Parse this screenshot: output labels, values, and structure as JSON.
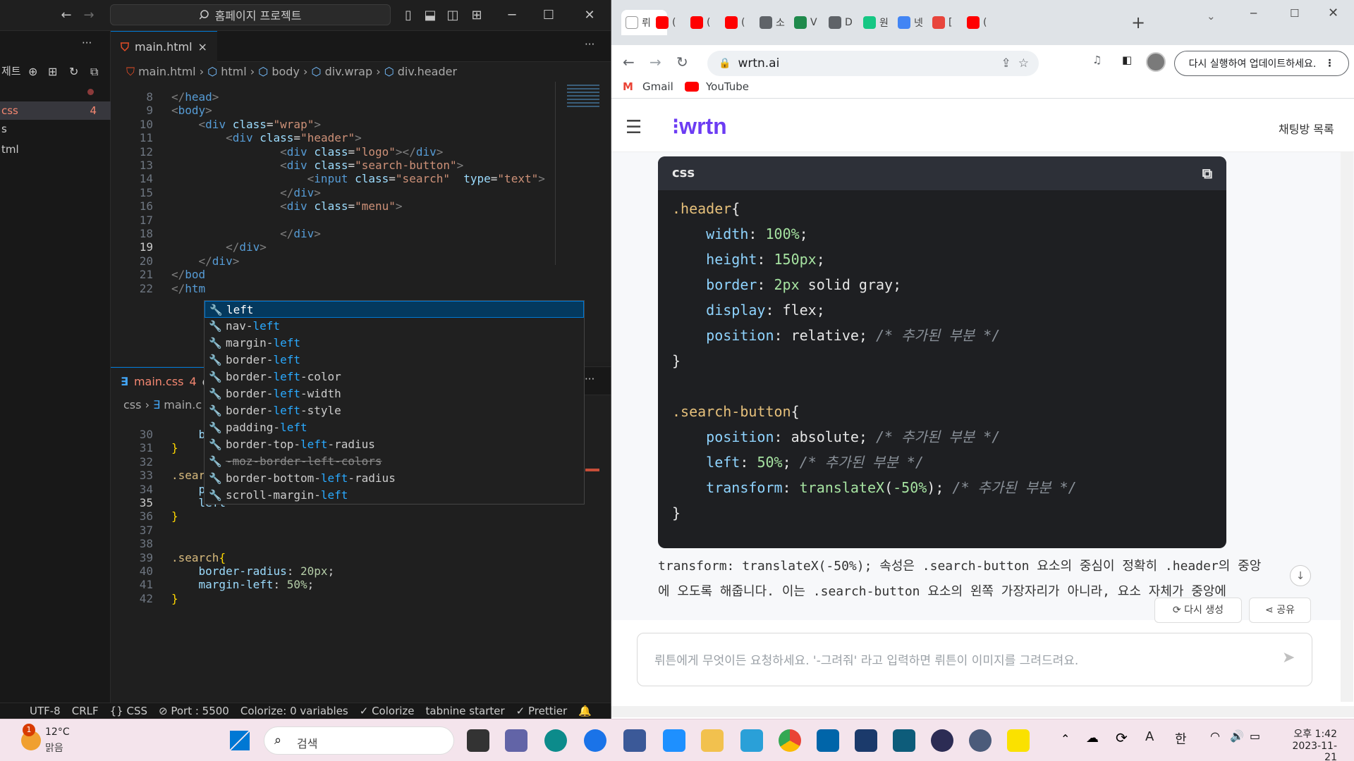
{
  "vscode": {
    "command_center": "홈페이지 프로젝트",
    "sidebar": {
      "item0": "제트",
      "item1": "css",
      "item1_badge": "4",
      "item2": "s",
      "item3": "tml"
    },
    "top_tab": {
      "label": "main.html",
      "close": "×"
    },
    "top_breadcrumb": [
      "main.html",
      "html",
      "body",
      "div.wrap",
      "div.header"
    ],
    "top_lines": [
      {
        "n": "8",
        "html": "<span class='t-punc'>&lt;/</span><span class='t-tag'>head</span><span class='t-punc'>&gt;</span>"
      },
      {
        "n": "9",
        "html": "<span class='t-punc'>&lt;</span><span class='t-tag'>body</span><span class='t-punc'>&gt;</span>"
      },
      {
        "n": "10",
        "html": "    <span class='t-punc'>&lt;</span><span class='t-tag'>div</span> <span class='t-attr'>class</span>=<span class='t-str'>\"wrap\"</span><span class='t-punc'>&gt;</span>"
      },
      {
        "n": "11",
        "html": "        <span class='t-punc'>&lt;</span><span class='t-tag'>div</span> <span class='t-attr'>class</span>=<span class='t-str'>\"header\"</span><span class='t-punc'>&gt;</span>"
      },
      {
        "n": "12",
        "html": "                <span class='t-punc'>&lt;</span><span class='t-tag'>div</span> <span class='t-attr'>class</span>=<span class='t-str'>\"logo\"</span><span class='t-punc'>&gt;&lt;/</span><span class='t-tag'>div</span><span class='t-punc'>&gt;</span>"
      },
      {
        "n": "13",
        "html": "                <span class='t-punc'>&lt;</span><span class='t-tag'>div</span> <span class='t-attr'>class</span>=<span class='t-str'>\"search-button\"</span><span class='t-punc'>&gt;</span>"
      },
      {
        "n": "14",
        "html": "                    <span class='t-punc'>&lt;</span><span class='t-tag'>input</span> <span class='t-attr'>class</span>=<span class='t-str'>\"search\"</span>  <span class='t-attr'>type</span>=<span class='t-str'>\"text\"</span><span class='t-punc'>&gt;</span>"
      },
      {
        "n": "15",
        "html": "                <span class='t-punc'>&lt;/</span><span class='t-tag'>div</span><span class='t-punc'>&gt;</span>"
      },
      {
        "n": "16",
        "html": "                <span class='t-punc'>&lt;</span><span class='t-tag'>div</span> <span class='t-attr'>class</span>=<span class='t-str'>\"menu\"</span><span class='t-punc'>&gt;</span>"
      },
      {
        "n": "17",
        "html": ""
      },
      {
        "n": "18",
        "html": "                <span class='t-punc'>&lt;/</span><span class='t-tag'>div</span><span class='t-punc'>&gt;</span>"
      },
      {
        "n": "19",
        "html": "        <span class='t-punc'>&lt;/</span><span class='t-tag'>div</span><span class='t-punc'>&gt;</span>"
      },
      {
        "n": "20",
        "html": "    <span class='t-punc'>&lt;/</span><span class='t-tag'>div</span><span class='t-punc'>&gt;</span>"
      },
      {
        "n": "21",
        "html": "<span class='t-punc'>&lt;/</span><span class='t-tag'>bod</span>"
      },
      {
        "n": "22",
        "html": "<span class='t-punc'>&lt;/</span><span class='t-tag'>htm</span>"
      }
    ],
    "bottom_tab": {
      "label": "main.css",
      "badge": "4"
    },
    "bottom_breadcrumb": [
      "css",
      "main.c"
    ],
    "bottom_lines": [
      {
        "n": "30",
        "html": "    <span class='t-prop'>b</span>"
      },
      {
        "n": "31",
        "html": "<span class='t-brace'>}</span>"
      },
      {
        "n": "32",
        "html": ""
      },
      {
        "n": "33",
        "html": "<span class='t-sel'>.sear</span>"
      },
      {
        "n": "34",
        "html": "    <span class='t-prop'>p</span>"
      },
      {
        "n": "35",
        "html": "    <span class='t-prop'>left</span>"
      },
      {
        "n": "36",
        "html": "<span class='t-brace'>}</span>"
      },
      {
        "n": "37",
        "html": ""
      },
      {
        "n": "38",
        "html": ""
      },
      {
        "n": "39",
        "html": "<span class='t-sel'>.search</span><span class='t-brace'>{</span>"
      },
      {
        "n": "40",
        "html": "    <span class='t-prop'>border-radius</span>: <span class='t-num'>20px</span>;"
      },
      {
        "n": "41",
        "html": "    <span class='t-prop'>margin-left</span>: <span class='t-num'>50%</span>;"
      },
      {
        "n": "42",
        "html": "<span class='t-brace'>}</span>"
      }
    ],
    "suggestions": [
      {
        "pre": "",
        "hl": "left",
        "post": "",
        "selected": true
      },
      {
        "pre": "nav-",
        "hl": "left",
        "post": ""
      },
      {
        "pre": "margin-",
        "hl": "left",
        "post": ""
      },
      {
        "pre": "border-",
        "hl": "left",
        "post": ""
      },
      {
        "pre": "border-",
        "hl": "left",
        "post": "-color"
      },
      {
        "pre": "border-",
        "hl": "left",
        "post": "-width"
      },
      {
        "pre": "border-",
        "hl": "left",
        "post": "-style"
      },
      {
        "pre": "padding-",
        "hl": "left",
        "post": ""
      },
      {
        "pre": "border-top-",
        "hl": "left",
        "post": "-radius"
      },
      {
        "pre": "-moz-border-",
        "hl": "left",
        "post": "-colors",
        "deprecated": true
      },
      {
        "pre": "border-bottom-",
        "hl": "left",
        "post": "-radius"
      },
      {
        "pre": "scroll-margin-",
        "hl": "left",
        "post": ""
      }
    ],
    "statusbar": [
      "UTF-8",
      "CRLF",
      "{} CSS",
      "⊘ Port : 5500",
      "Colorize: 0 variables",
      "✓ Colorize",
      "tabnine starter",
      "✓ Prettier"
    ]
  },
  "chrome": {
    "new_tab": "+",
    "url": "wrtn.ai",
    "update_button": "다시 실행하여 업데이트하세요.",
    "bookmarks": [
      "Gmail",
      "YouTube"
    ],
    "tabs": [
      {
        "text": "뤼",
        "color": "#ffffff"
      },
      {
        "text": "(",
        "color": "#ff0000"
      },
      {
        "text": "(",
        "color": "#ff0000"
      },
      {
        "text": "(",
        "color": "#ff0000"
      },
      {
        "text": "소",
        "color": "#5f6368"
      },
      {
        "text": "V",
        "color": "#1f8a4c"
      },
      {
        "text": "D",
        "color": "#5f6368"
      },
      {
        "text": "원",
        "color": "#16c784"
      },
      {
        "text": "넷",
        "color": "#4285f4"
      },
      {
        "text": "[",
        "color": "#e8453c"
      },
      {
        "text": "(",
        "color": "#ff0000"
      }
    ]
  },
  "wrtn": {
    "logo": "wrtn",
    "chat_list": "채팅방 목록",
    "code_lang": "css",
    "code_lines": [
      {
        "html": "<span class='s'>.header</span>{"
      },
      {
        "html": "    <span class='p'>width</span>: <span class='v'>100%</span>;"
      },
      {
        "html": "    <span class='p'>height</span>: <span class='v'>150px</span>;"
      },
      {
        "html": "    <span class='p'>border</span>: <span class='v'>2px</span> solid gray;"
      },
      {
        "html": "    <span class='p'>display</span>: flex;"
      },
      {
        "html": "    <span class='p'>position</span>: relative; <span class='cm'>/* 추가된 부분 */</span>"
      },
      {
        "html": "}"
      },
      {
        "html": ""
      },
      {
        "html": "<span class='s'>.search-button</span>{"
      },
      {
        "html": "    <span class='p'>position</span>: absolute; <span class='cm'>/* 추가된 부분 */</span>"
      },
      {
        "html": "    <span class='p'>left</span>: <span class='v'>50%</span>; <span class='cm'>/* 추가된 부분 */</span>"
      },
      {
        "html": "    <span class='p'>transform</span>: <span class='v'>translateX</span>(<span class='v'>-50%</span>); <span class='cm'>/* 추가된 부분 */</span>"
      },
      {
        "html": "}"
      }
    ],
    "explanation_line1": "transform: translateX(-50%); 속성은 .search-button 요소의 중심이 정확히 .header의 중앙",
    "explanation_line2": "에 오도록 해줍니다. 이는 .search-button 요소의 왼쪽 가장자리가 아니라, 요소 자체가 중앙에 오도록 해주기",
    "regenerate": "다시 생성",
    "share": "공유",
    "prompt_placeholder": "뤼튼에게 무엇이든 요청하세요. '-그려줘' 라고 입력하면 뤼튼이 이미지를 그려드려요."
  },
  "taskbar": {
    "weather_temp": "12°C",
    "weather_desc": "맑음",
    "weather_badge": "1",
    "search": "검색",
    "ime_a": "A",
    "ime_lang": "한",
    "time": "오후 1:42",
    "date": "2023-11-21"
  }
}
